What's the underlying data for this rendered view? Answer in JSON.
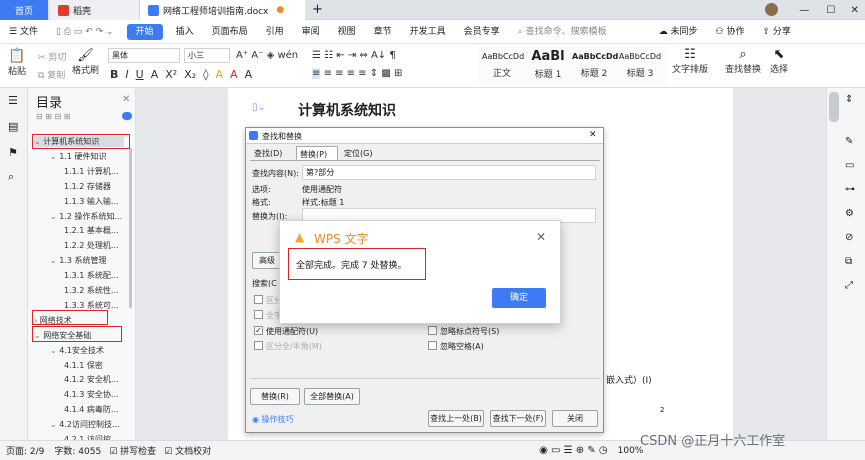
{
  "tabs": {
    "home": "首页",
    "daoke": "稻壳",
    "doc": "网络工程师培训指南.docx",
    "add": "+"
  },
  "menu": {
    "file": "文件",
    "items": [
      "开始",
      "插入",
      "页面布局",
      "引用",
      "审阅",
      "视图",
      "章节",
      "开发工具",
      "会员专享"
    ],
    "search": "查找命令、搜索模板",
    "unsync": "未同步",
    "collab": "协作",
    "share": "分享"
  },
  "ribbon": {
    "paste": "粘贴",
    "cut": "剪切",
    "copy": "复制",
    "format_painter": "格式刷",
    "font": "黑体",
    "size": "小三",
    "styles": [
      {
        "preview": "AaBbCcDd",
        "label": "正文"
      },
      {
        "preview": "AaBl",
        "label": "标题 1"
      },
      {
        "preview": "AaBbCcDd",
        "label": "标题 2"
      },
      {
        "preview": "AaBbCcDd",
        "label": "标题 3"
      }
    ],
    "text_layout": "文字排版",
    "find_replace": "查找替换",
    "select": "选择"
  },
  "toc": {
    "title": "目录",
    "items": [
      {
        "t": "计算机系统知识",
        "lvl": 0
      },
      {
        "t": "1.1 硬件知识",
        "lvl": 1
      },
      {
        "t": "1.1.1 计算机...",
        "lvl": 2
      },
      {
        "t": "1.1.2 存储器",
        "lvl": 2
      },
      {
        "t": "1.1.3 输入输...",
        "lvl": 2
      },
      {
        "t": "1.2 操作系统知...",
        "lvl": 1
      },
      {
        "t": "1.2.1 基本概...",
        "lvl": 2
      },
      {
        "t": "1.2.2 处理机...",
        "lvl": 2
      },
      {
        "t": "1.3 系统管理",
        "lvl": 1
      },
      {
        "t": "1.3.1 系统配...",
        "lvl": 2
      },
      {
        "t": "1.3.2 系统性...",
        "lvl": 2
      },
      {
        "t": "1.3.3 系统可...",
        "lvl": 2
      },
      {
        "t": "网络技术",
        "lvl": 0
      },
      {
        "t": "网络安全基础",
        "lvl": 0
      },
      {
        "t": "4.1安全技术",
        "lvl": 1
      },
      {
        "t": "4.1.1 保密",
        "lvl": 2
      },
      {
        "t": "4.1.2 安全机...",
        "lvl": 2
      },
      {
        "t": "4.1.3 安全协...",
        "lvl": 2
      },
      {
        "t": "4.1.4 病毒防...",
        "lvl": 2
      },
      {
        "t": "4.2访问控制技...",
        "lvl": 1
      },
      {
        "t": "4.2.1 访问控...",
        "lvl": 2
      }
    ]
  },
  "doc": {
    "heading": "计算机系统知识",
    "text1": "嵌入式）(I)",
    "text2": "2"
  },
  "dialog": {
    "title": "查找和替换",
    "tabs": [
      "查找(D)",
      "替换(P)",
      "定位(G)"
    ],
    "find_label": "查找内容(N):",
    "find_value": "第?部分",
    "options_label": "选项:",
    "options_value": "使用通配符",
    "format_label": "格式:",
    "format_value": "样式:标题 1",
    "replace_label": "替换为(I):",
    "advanced": "高级",
    "search_label": "搜索(C",
    "cb1": "区分",
    "cb2": "全字",
    "use_wildcard": "使用通配符(U)",
    "full_half": "区分全/半角(M)",
    "ignore_punct": "忽略标点符号(S)",
    "ignore_space": "忽略空格(A)",
    "replace_btn": "替换(R)",
    "replace_all_btn": "全部替换(A)",
    "tips": "操作技巧",
    "find_prev": "查找上一处(B)",
    "find_next": "查找下一处(F)",
    "close": "关闭"
  },
  "wps_alert": {
    "title": "WPS 文字",
    "message": "全部完成。完成 7 处替换。",
    "ok": "确定"
  },
  "status": {
    "page": "页面: 2/9",
    "words": "字数: 4055",
    "spell": "拼写检查",
    "doc_check": "文档校对",
    "zoom": "100%"
  },
  "watermark": "CSDN @正月十六工作室",
  "colors": {
    "accent": "#3d7bf5",
    "red_box": "#d9262c",
    "warn": "#f5a623"
  }
}
